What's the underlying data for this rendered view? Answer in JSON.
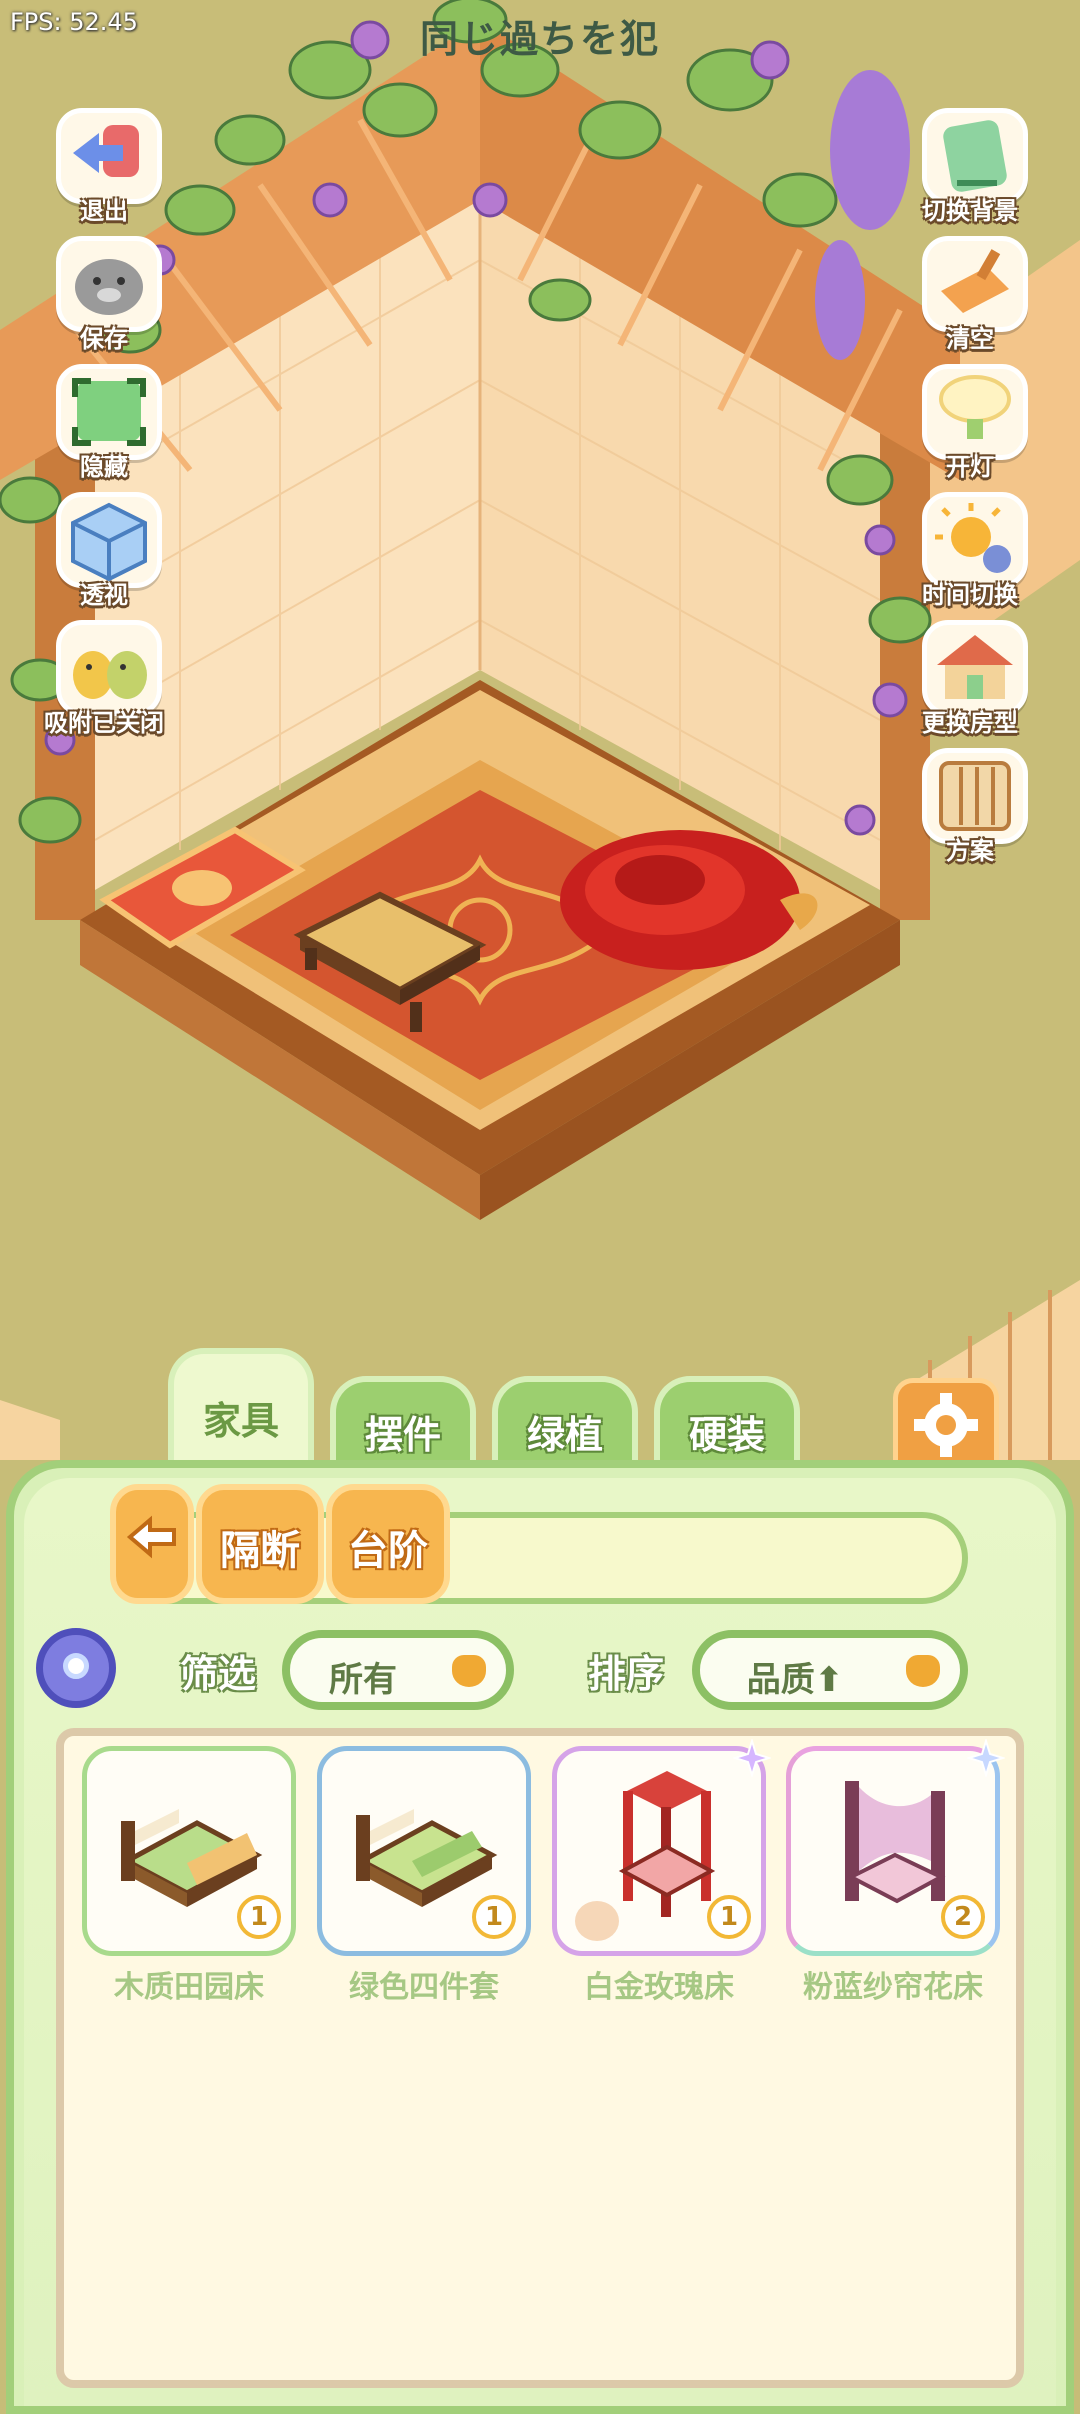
{
  "overlay": {
    "fps": "FPS: 52.45",
    "title": "同じ過ちを犯"
  },
  "left_buttons": [
    {
      "label": "退出",
      "icon": "exit-door-icon"
    },
    {
      "label": "保存",
      "icon": "hamster-save-icon"
    },
    {
      "label": "隐藏",
      "icon": "hide-frame-icon"
    },
    {
      "label": "透视",
      "icon": "cube-perspective-icon"
    },
    {
      "label": "吸附已关闭",
      "icon": "chicks-snap-icon"
    }
  ],
  "right_buttons": [
    {
      "label": "切换背景",
      "icon": "background-switch-icon"
    },
    {
      "label": "清空",
      "icon": "dustpan-clear-icon"
    },
    {
      "label": "开灯",
      "icon": "lamp-icon"
    },
    {
      "label": "时间切换",
      "icon": "sun-moon-icon"
    },
    {
      "label": "更换房型",
      "icon": "house-icon"
    },
    {
      "label": "方案",
      "icon": "plan-book-icon"
    }
  ],
  "tabs": [
    {
      "label": "家具",
      "active": true
    },
    {
      "label": "摆件",
      "active": false
    },
    {
      "label": "绿植",
      "active": false
    },
    {
      "label": "硬装",
      "active": false
    }
  ],
  "settings_icon": "gear-icon",
  "subcategory": {
    "back_icon": "back-arrow-icon",
    "items": [
      "隔断",
      "台阶"
    ]
  },
  "filter": {
    "label": "筛选",
    "value": "所有"
  },
  "sort": {
    "label": "排序",
    "value": "品质⬆"
  },
  "items": [
    {
      "name": "木质田园床",
      "qty": "1",
      "frame": "green",
      "special": false
    },
    {
      "name": "绿色四件套",
      "qty": "1",
      "frame": "blue",
      "special": false
    },
    {
      "name": "白金玫瑰床",
      "qty": "1",
      "frame": "purple",
      "special": true
    },
    {
      "name": "粉蓝纱帘花床",
      "qty": "2",
      "frame": "rainbow",
      "special": true
    }
  ]
}
